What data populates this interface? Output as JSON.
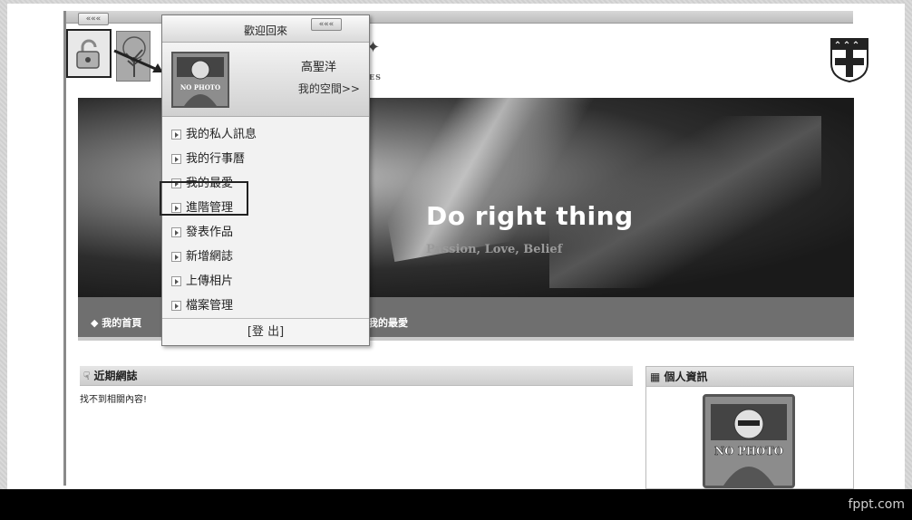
{
  "top": {
    "collapse_label": "«««",
    "lock_icon": "unlock-icon"
  },
  "school": {
    "mark_es": "ES"
  },
  "banner": {
    "title": "Do right thing",
    "subtitle": "Passion, Love, Belief"
  },
  "nav": {
    "home": "◆ 我的首頁",
    "favorites": "我的最愛"
  },
  "blog": {
    "title": "近期網誌",
    "empty": "找不到相關內容!"
  },
  "info": {
    "title": "個人資訊",
    "photo_label": "NO PHOTO"
  },
  "dropdown": {
    "welcome": "歡迎回來",
    "user_name": "高聖洋",
    "my_space": "我的空間>>",
    "avatar_label": "NO PHOTO",
    "items": [
      {
        "label": "我的私人訊息"
      },
      {
        "label": "我的行事曆"
      },
      {
        "label": "我的最愛"
      },
      {
        "label": "進階管理"
      },
      {
        "label": "發表作品"
      },
      {
        "label": "新增網誌"
      },
      {
        "label": "上傳相片"
      },
      {
        "label": "檔案管理"
      }
    ],
    "logout": "[登 出]"
  },
  "footer": {
    "brand": "fppt.com"
  }
}
